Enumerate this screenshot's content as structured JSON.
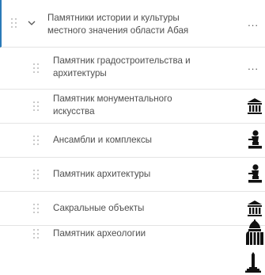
{
  "layers": {
    "group": {
      "label_line1": "Памятники истории и культуры",
      "label_line2": "местного значения области Абая",
      "menu": "..."
    },
    "items": [
      {
        "line1": "Памятник градостроительства и",
        "line2": "архитектуры",
        "menu": "...",
        "symbol": "none"
      },
      {
        "line1": "Памятник монументального",
        "line2": "искусства",
        "symbol": "museum-building-icon"
      },
      {
        "line1": "Ансамбли и комплексы",
        "line2": "",
        "symbol": "monument-statue-icon"
      },
      {
        "line1": "Памятник архитектуры",
        "line2": "",
        "symbol": "monument-statue-icon"
      },
      {
        "line1": "Сакральные объекты",
        "line2": "",
        "symbol": "museum-building-icon"
      },
      {
        "line1": "Памятник археологии",
        "line2": "",
        "symbol": "archaeology-dome-icon"
      }
    ],
    "trailing_symbol": "obelisk-icon"
  },
  "colors": {
    "accent": "#2a7ab8",
    "text": "#4f4f4f",
    "divider": "#e4e4e4",
    "handle": "#b8b8b8",
    "symbol": "#111111"
  }
}
